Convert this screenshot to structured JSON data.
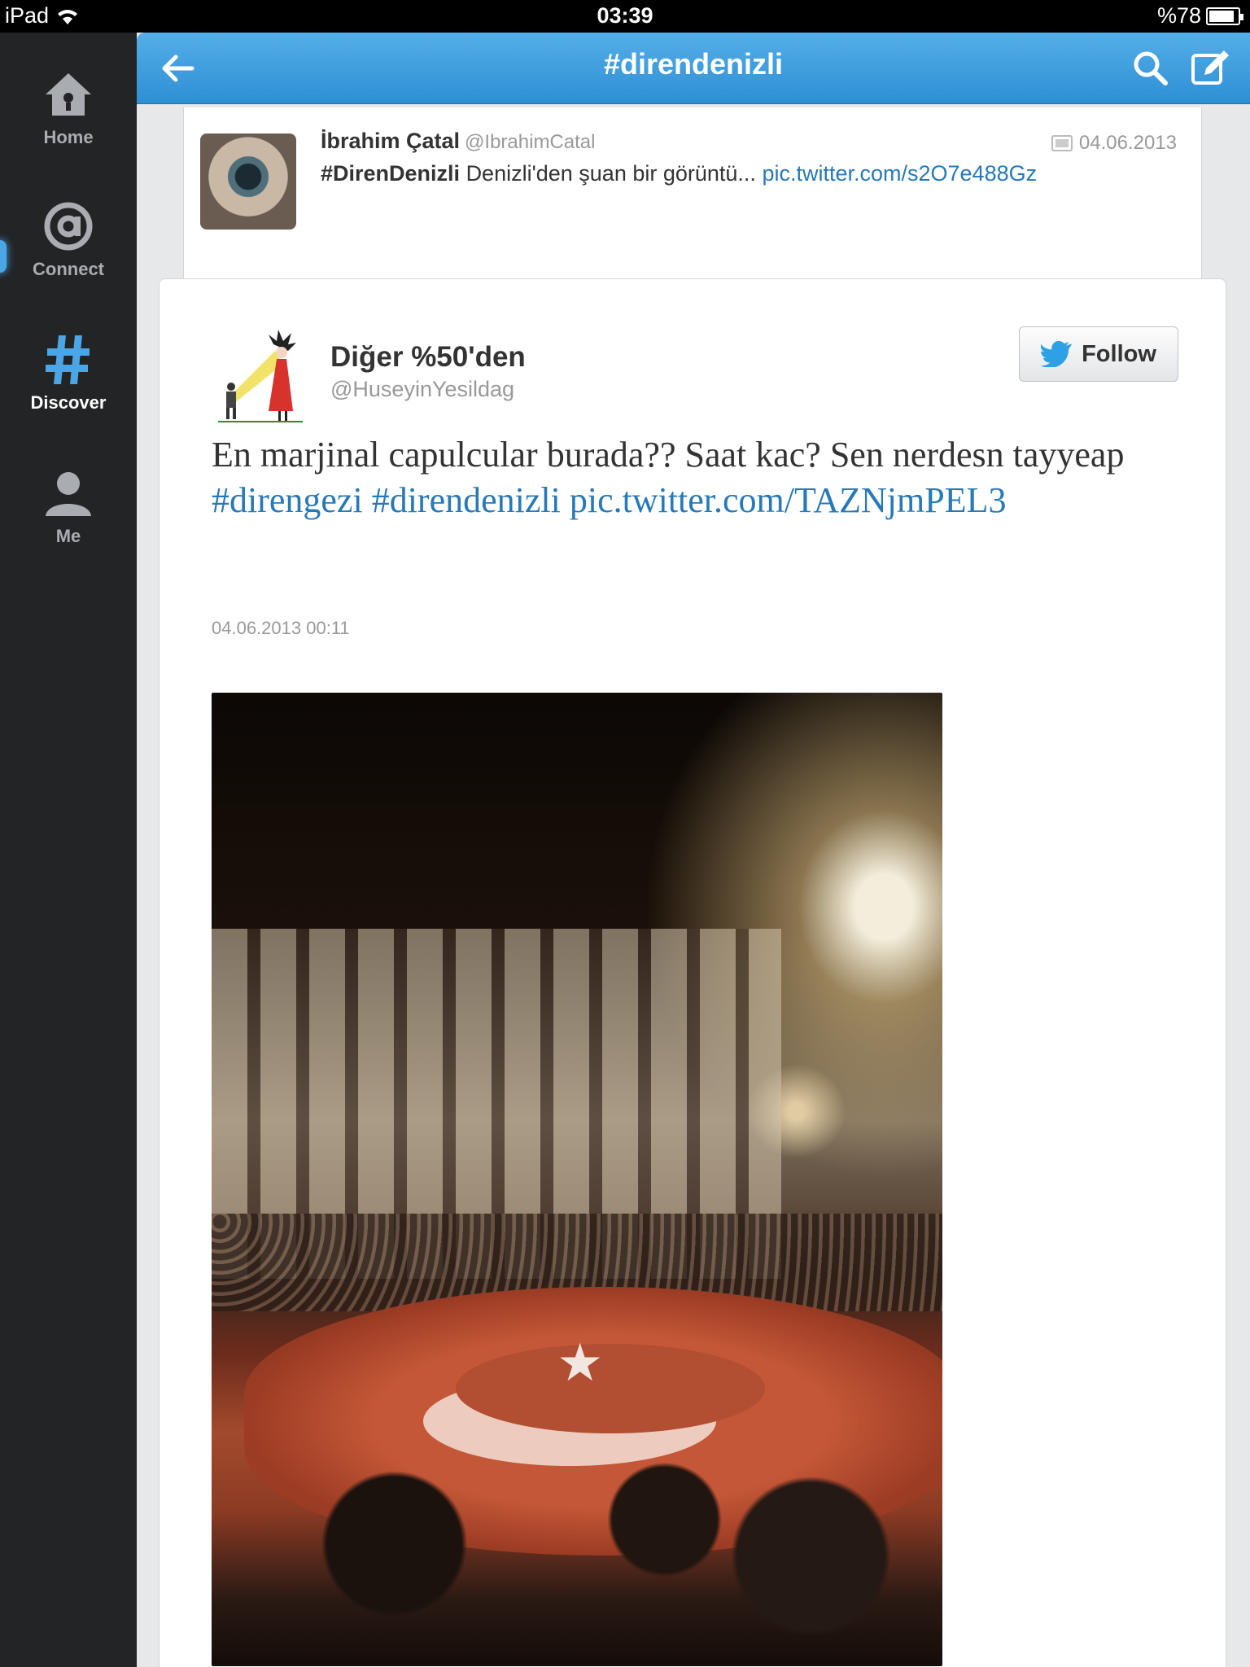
{
  "status_bar": {
    "device": "iPad",
    "time": "03:39",
    "battery": "%78",
    "battery_level": 0.78
  },
  "sidebar": {
    "items": [
      {
        "label": "Home",
        "icon": "home-icon"
      },
      {
        "label": "Connect",
        "icon": "at-icon"
      },
      {
        "label": "Discover",
        "icon": "hashtag-icon",
        "active": true
      },
      {
        "label": "Me",
        "icon": "person-icon"
      }
    ]
  },
  "header": {
    "title": "#direndenizli"
  },
  "previous_tweet": {
    "name": "İbrahim Çatal",
    "handle": "@IbrahimCatal",
    "date": "04.06.2013",
    "hashtag": "#DirenDenizli",
    "text": "Denizli'den şuan bir görüntü...",
    "link": "pic.twitter.com/s2O7e488Gz"
  },
  "tweet": {
    "name": "Diğer %50'den",
    "handle": "@HuseyinYesildag",
    "follow_label": "Follow",
    "text_plain": "En marjinal capulcular burada?? Saat kac? Sen nerdesn tayyeap",
    "hashtag_1": "#direngezi",
    "hashtag_2": "#direndenizli",
    "link": "pic.twitter.com/TAZNjmPEL3",
    "timestamp": "04.06.2013 00:11"
  },
  "colors": {
    "accent": "#2d8fd4",
    "link": "#2779b8",
    "sidebar_bg": "#222426"
  }
}
